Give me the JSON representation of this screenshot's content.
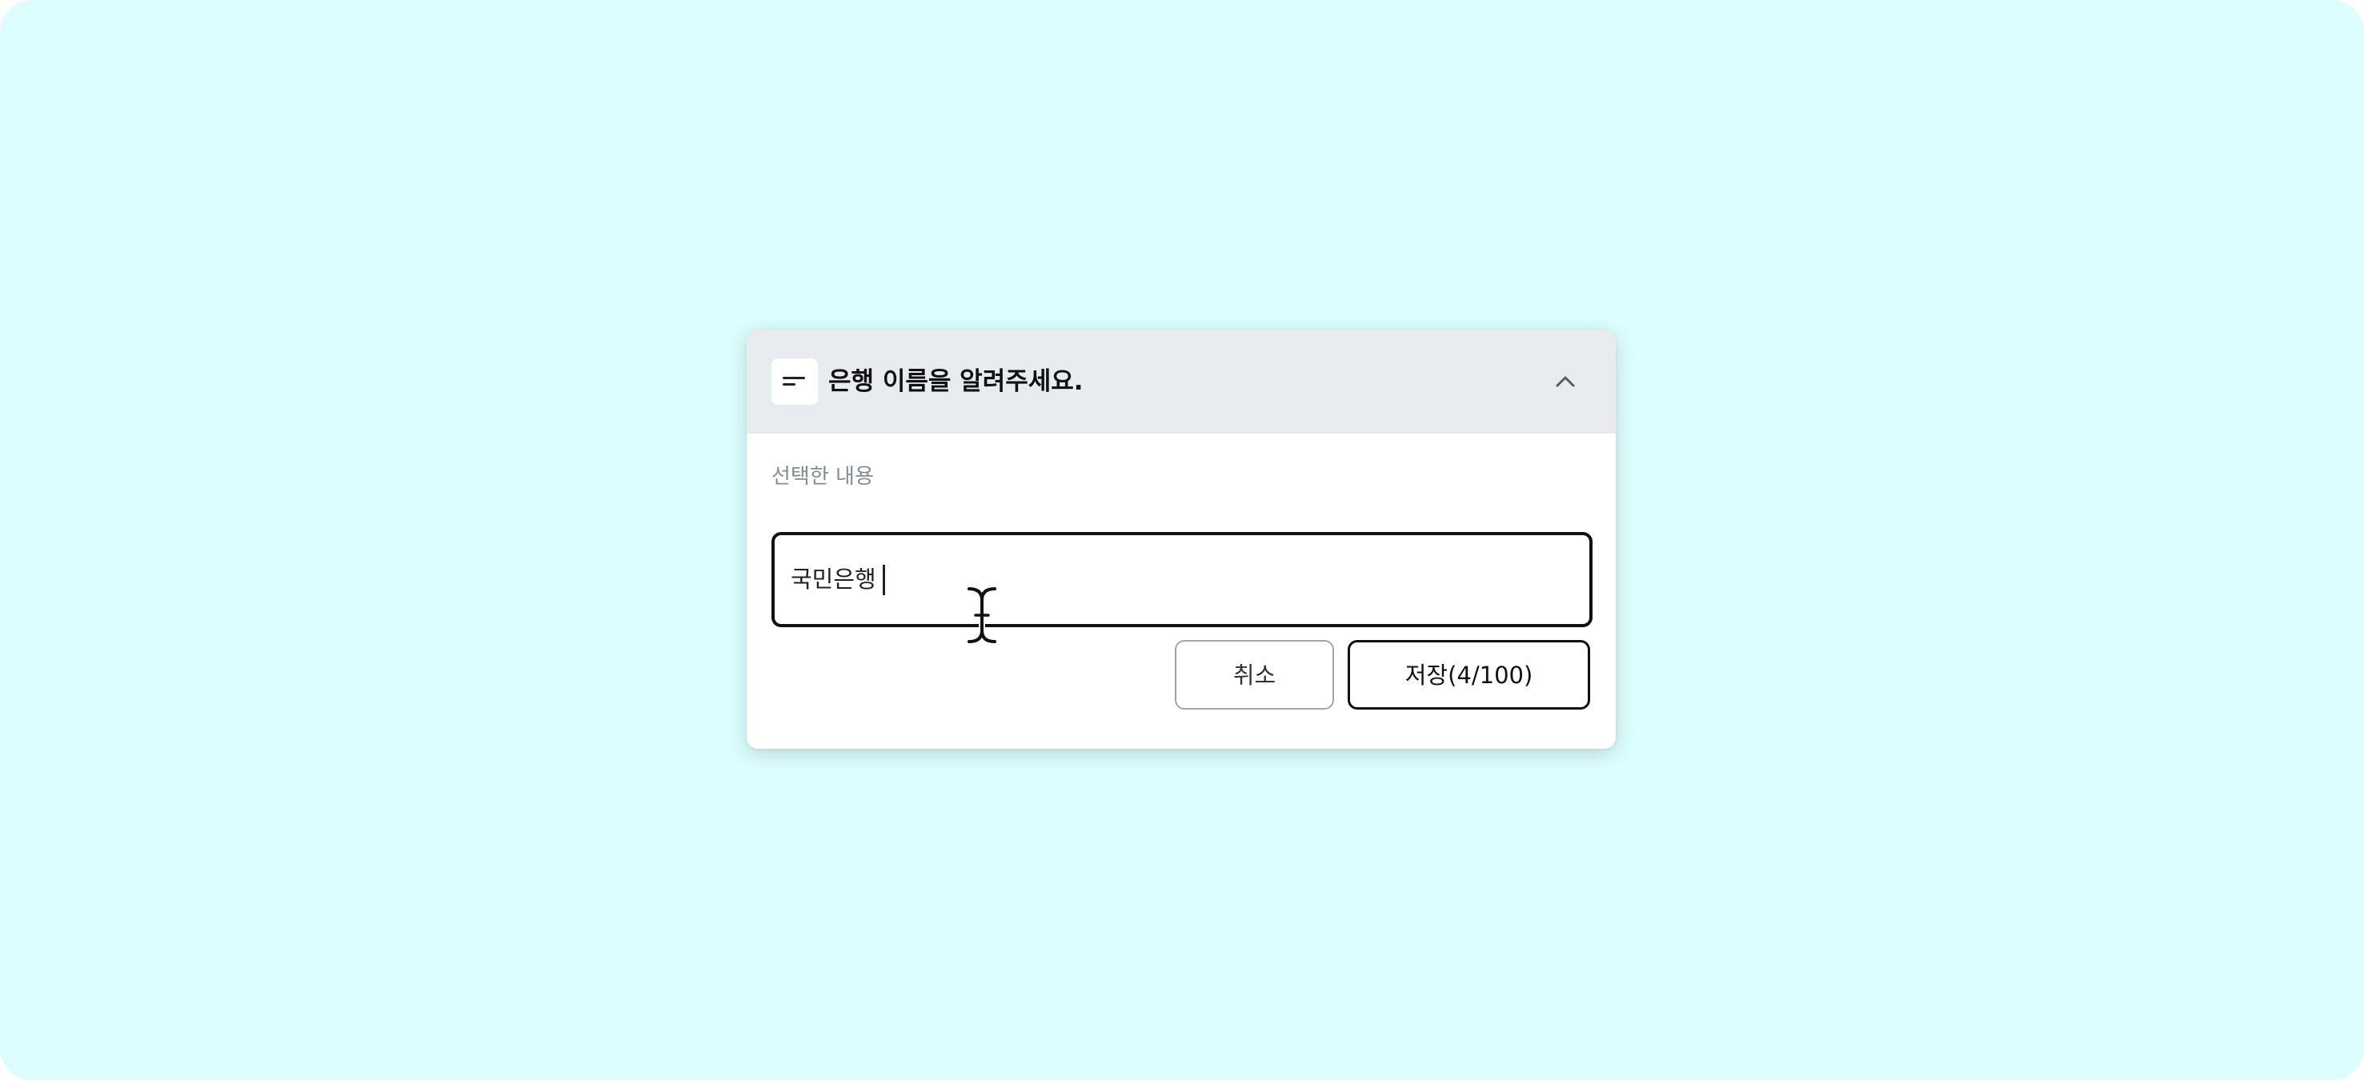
{
  "dialog": {
    "title": "은행 이름을 알려주세요.",
    "header_icon": "short-text-icon",
    "collapse_icon": "chevron-up-icon"
  },
  "form": {
    "label": "선택한 내용",
    "input_value": "국민은행"
  },
  "actions": {
    "cancel_label": "취소",
    "save_label": "저장(4/100)"
  },
  "colors": {
    "background": "#dcfefe",
    "header_bg": "#e8ecef",
    "label_text": "#858b92",
    "input_border": "#111111"
  },
  "cursor": "text-cursor-icon"
}
